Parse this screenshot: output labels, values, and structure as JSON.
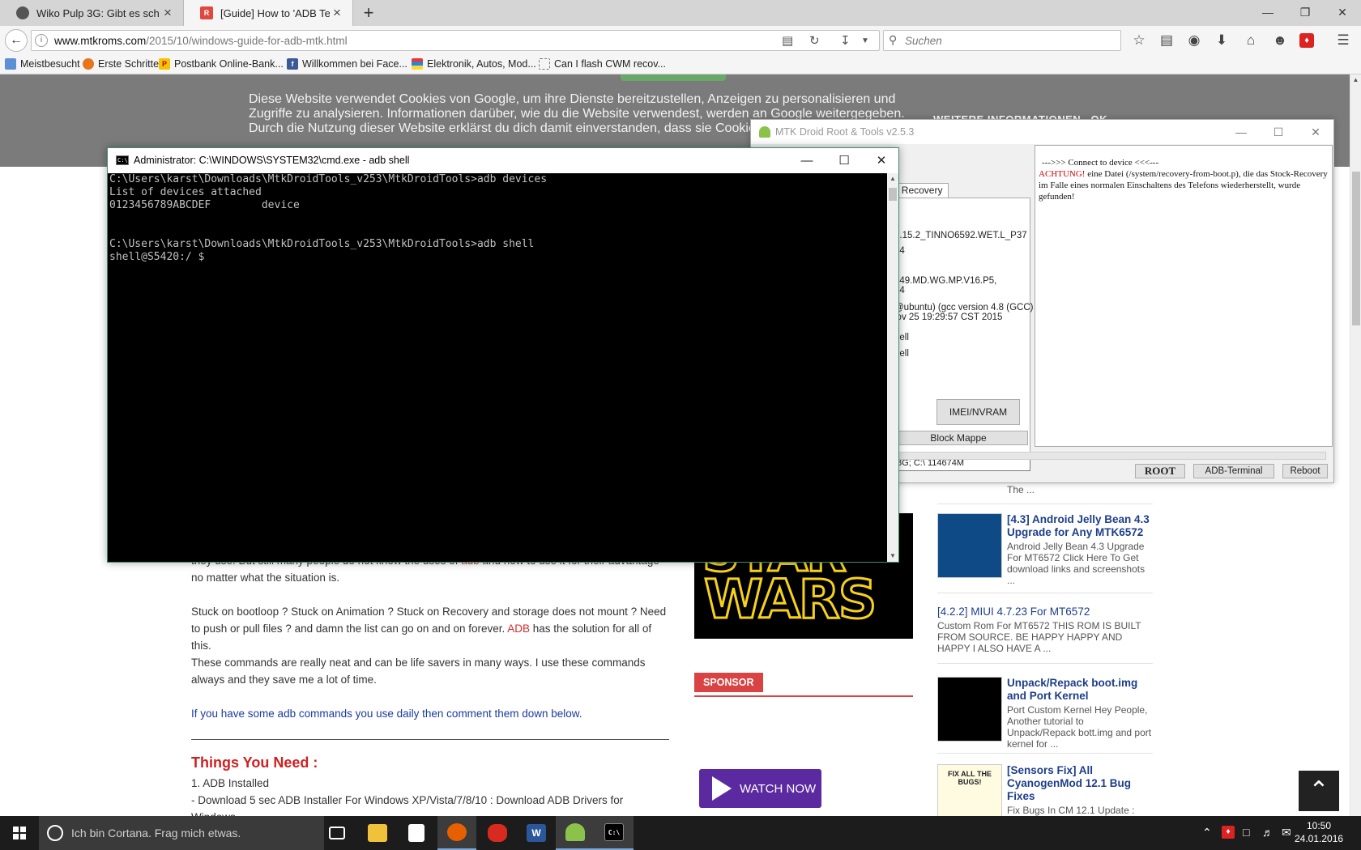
{
  "browser": {
    "tabs": [
      {
        "label": "Wiko Pulp 3G: Gibt es sch...",
        "icon": "android-icon"
      },
      {
        "label": "[Guide] How to 'ADB Ter...",
        "icon": "mtkroms-icon"
      }
    ],
    "url_domain": "www.mtkroms.com",
    "url_path": "/2015/10/windows-guide-for-adb-mtk.html",
    "search_placeholder": "Suchen",
    "bookmarks": [
      "Meistbesucht",
      "Erste Schritte",
      "Postbank Online-Bank...",
      "Willkommen bei Face...",
      "Elektronik, Autos, Mod...",
      "Can I flash CWM recov..."
    ]
  },
  "webpage": {
    "cookie_text": "Diese Website verwendet Cookies von Google, um ihre Dienste bereitzustellen, Anzeigen zu personalisieren und Zugriffe zu analysieren. Informationen darüber, wie du die Website verwendest, werden an Google weitergegeben. Durch die Nutzung dieser Website erklärst du dich damit einverstanden, dass sie Cookies verwendet.",
    "cookie_more": "WEITERE INFORMATIONEN",
    "cookie_ok": "OK",
    "article": {
      "p1_a": "they use. But still many people do not know the uses of ",
      "p1_adb": "adb",
      "p1_b": " and how to use it for their advantage no matter what the situation is.",
      "p2_a": "Stuck on bootloop ? Stuck on Animation ? Stuck on Recovery and storage does not mount ? Need to push or pull files ? and damn the list can go on and on forever. ",
      "p2_adb": "ADB",
      "p2_b": " has the solution for all of this.",
      "p3": "These commands are really neat and can be life savers in many ways. I use these commands always and they save me a lot of time.",
      "p4": "If you have some adb commands you use daily then comment them down below.",
      "heading": "Things You Need :",
      "item1": "1. ADB Installed",
      "item2": "- Download 5 sec ADB Installer For Windows XP/Vista/7/8/10 : Download ADB Drivers for Windows"
    },
    "starwars_line1": "STAR",
    "starwars_line2": "WARS",
    "sponsor_label": "SPONSOR",
    "watch_now": "WATCH NOW",
    "sidebar_posts": [
      {
        "title": "",
        "excerpt": "The ..."
      },
      {
        "title": "[4.3] Android Jelly Bean 4.3 Upgrade for Any MTK6572",
        "excerpt": "Android Jelly Bean 4.3 Upgrade For MT6572 Click Here To Get download links and screenshots ..."
      },
      {
        "title": "[4.2.2] MIUI 4.7.23 For MT6572",
        "excerpt": "Custom Rom For MT6572 THIS ROM IS BUILT FROM SOURCE. BE HAPPY HAPPY AND HAPPY I ALSO HAVE A ..."
      },
      {
        "title": "Unpack/Repack boot.img and Port Kernel",
        "excerpt": "Port Custom Kernel Hey People, Another tutorial to Unpack/Repack bott.img and port kernel for ..."
      },
      {
        "title": "[Sensors Fix] All CyanogenMod 12.1 Bug Fixes",
        "excerpt": "Fix Bugs In CM 12.1 Update :"
      }
    ],
    "fix_thumb_text": "FIX ALL THE BUGS!"
  },
  "mtk_window": {
    "title": "MTK Droid Root & Tools v2.5.3",
    "tab_label": "y, Recovery",
    "info_lines": [
      "2.15.2_TINNO6592.WET.L_P37",
      "14",
      "449.MD.WG.MP.V16.P5,",
      "44",
      "@ubuntu) (gcc version 4.8 (GCC)",
      "lov 25 19:29:57 CST 2015",
      "nell",
      "nell"
    ],
    "imei_button": "IMEI/NVRAM",
    "block_button": "Block Mappe",
    "storage_field": ".8G;  C:\\ 114674M",
    "log_line1": "--->>> Connect to device <<<---",
    "log_warning": "ACHTUNG!",
    "log_line2": "  eine Datei (/system/recovery-from-boot.p), die das Stock-Recovery im Falle eines normalen Einschaltens des Telefons wiederherstellt, wurde gefunden!",
    "root_button": "ROOT",
    "adb_terminal_button": "ADB-Terminal",
    "reboot_button": "Reboot"
  },
  "cmd_window": {
    "title": "Administrator: C:\\WINDOWS\\SYSTEM32\\cmd.exe - adb  shell",
    "lines": [
      "",
      "C:\\Users\\karst\\Downloads\\MtkDroidTools_v253\\MtkDroidTools>adb devices",
      "List of devices attached",
      "0123456789ABCDEF        device",
      "",
      "",
      "C:\\Users\\karst\\Downloads\\MtkDroidTools_v253\\MtkDroidTools>adb shell",
      "shell@S5420:/ $"
    ]
  },
  "taskbar": {
    "cortana_placeholder": "Ich bin Cortana. Frag mich etwas.",
    "time": "10:50",
    "date": "24.01.2016"
  }
}
